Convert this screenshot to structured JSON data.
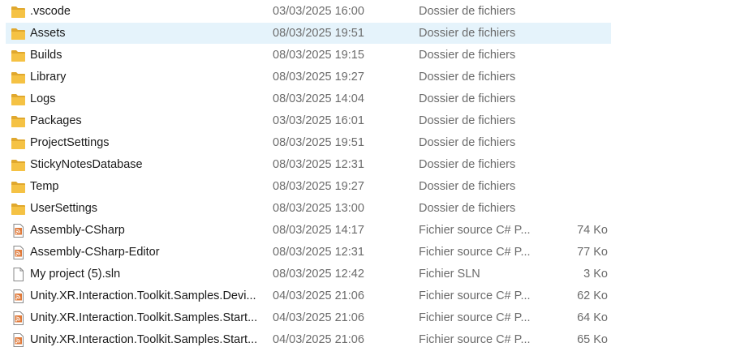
{
  "files": [
    {
      "name": ".vscode",
      "date": "03/03/2025 16:00",
      "type": "Dossier de fichiers",
      "size": "",
      "icon": "folder-icon"
    },
    {
      "name": "Assets",
      "date": "08/03/2025 19:51",
      "type": "Dossier de fichiers",
      "size": "",
      "icon": "folder-icon",
      "selected": true
    },
    {
      "name": "Builds",
      "date": "08/03/2025 19:15",
      "type": "Dossier de fichiers",
      "size": "",
      "icon": "folder-icon"
    },
    {
      "name": "Library",
      "date": "08/03/2025 19:27",
      "type": "Dossier de fichiers",
      "size": "",
      "icon": "folder-icon"
    },
    {
      "name": "Logs",
      "date": "08/03/2025 14:04",
      "type": "Dossier de fichiers",
      "size": "",
      "icon": "folder-icon"
    },
    {
      "name": "Packages",
      "date": "03/03/2025 16:01",
      "type": "Dossier de fichiers",
      "size": "",
      "icon": "folder-icon"
    },
    {
      "name": "ProjectSettings",
      "date": "08/03/2025 19:51",
      "type": "Dossier de fichiers",
      "size": "",
      "icon": "folder-icon"
    },
    {
      "name": "StickyNotesDatabase",
      "date": "08/03/2025 12:31",
      "type": "Dossier de fichiers",
      "size": "",
      "icon": "folder-icon"
    },
    {
      "name": "Temp",
      "date": "08/03/2025 19:27",
      "type": "Dossier de fichiers",
      "size": "",
      "icon": "folder-icon"
    },
    {
      "name": "UserSettings",
      "date": "08/03/2025 13:00",
      "type": "Dossier de fichiers",
      "size": "",
      "icon": "folder-icon"
    },
    {
      "name": "Assembly-CSharp",
      "date": "08/03/2025 14:17",
      "type": "Fichier source C# P...",
      "size": "74 Ko",
      "icon": "csproj-file-icon"
    },
    {
      "name": "Assembly-CSharp-Editor",
      "date": "08/03/2025 12:31",
      "type": "Fichier source C# P...",
      "size": "77 Ko",
      "icon": "csproj-file-icon"
    },
    {
      "name": "My project (5).sln",
      "date": "08/03/2025 12:42",
      "type": "Fichier SLN",
      "size": "3 Ko",
      "icon": "blank-file-icon"
    },
    {
      "name": "Unity.XR.Interaction.Toolkit.Samples.Devi...",
      "date": "04/03/2025 21:06",
      "type": "Fichier source C# P...",
      "size": "62 Ko",
      "icon": "csproj-file-icon"
    },
    {
      "name": "Unity.XR.Interaction.Toolkit.Samples.Start...",
      "date": "04/03/2025 21:06",
      "type": "Fichier source C# P...",
      "size": "64 Ko",
      "icon": "csproj-file-icon"
    },
    {
      "name": "Unity.XR.Interaction.Toolkit.Samples.Start...",
      "date": "04/03/2025 21:06",
      "type": "Fichier source C# P...",
      "size": "65 Ko",
      "icon": "csproj-file-icon"
    }
  ],
  "colors": {
    "folder": "#f5c244",
    "folder_dark": "#e0a82e",
    "selection": "#e5f3fb",
    "csproj_accent": "#e07a3a"
  }
}
